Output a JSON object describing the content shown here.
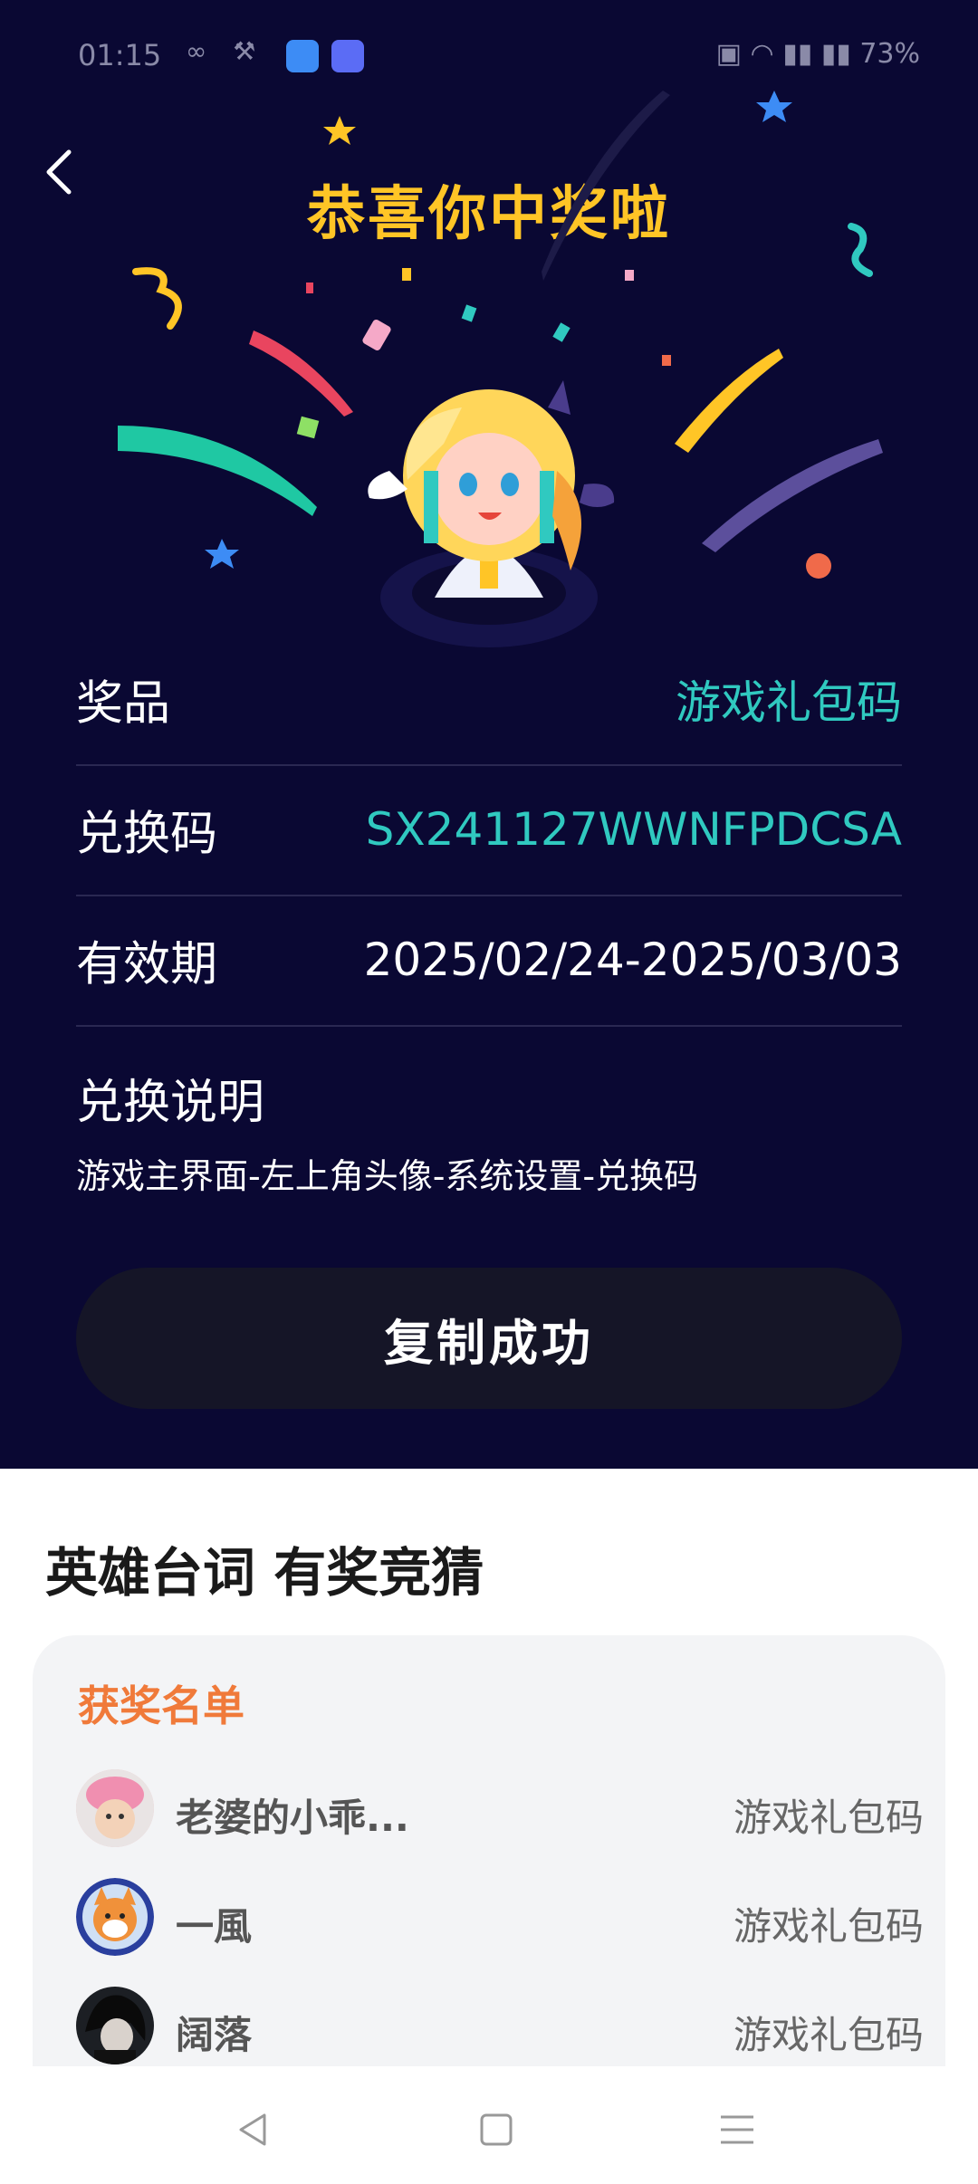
{
  "status_bar": {
    "time": "01:15",
    "battery": "73%"
  },
  "header": {
    "title": "恭喜你中奖啦"
  },
  "prize_details": [
    {
      "label": "奖品",
      "value": "游戏礼包码",
      "color": "#30c9c0"
    },
    {
      "label": "兑换码",
      "value": "SX241127WWNFPDCSA",
      "color": "#30c9c0"
    },
    {
      "label": "有效期",
      "value": "2025/02/24-2025/03/03",
      "color": "#ffffff"
    }
  ],
  "instructions": {
    "title": "兑换说明",
    "text": "游戏主界面-左上角头像-系统设置-兑换码"
  },
  "copy_button": {
    "label": "复制成功"
  },
  "section": {
    "title": "英雄台词 有奖竞猜"
  },
  "winners": {
    "title": "获奖名单",
    "items": [
      {
        "name": "老婆的小乖...",
        "prize": "游戏礼包码",
        "avatar": "pink-hat-avatar"
      },
      {
        "name": "一風",
        "prize": "游戏礼包码",
        "avatar": "shiba-dog-avatar"
      },
      {
        "name": "阔落",
        "prize": "游戏礼包码",
        "avatar": "dark-character-avatar"
      }
    ]
  },
  "colors": {
    "hero_bg": "#0a0833",
    "title_gold": "#ffc526",
    "accent_teal": "#30c9c0",
    "winner_title_orange": "#f07a3a"
  }
}
